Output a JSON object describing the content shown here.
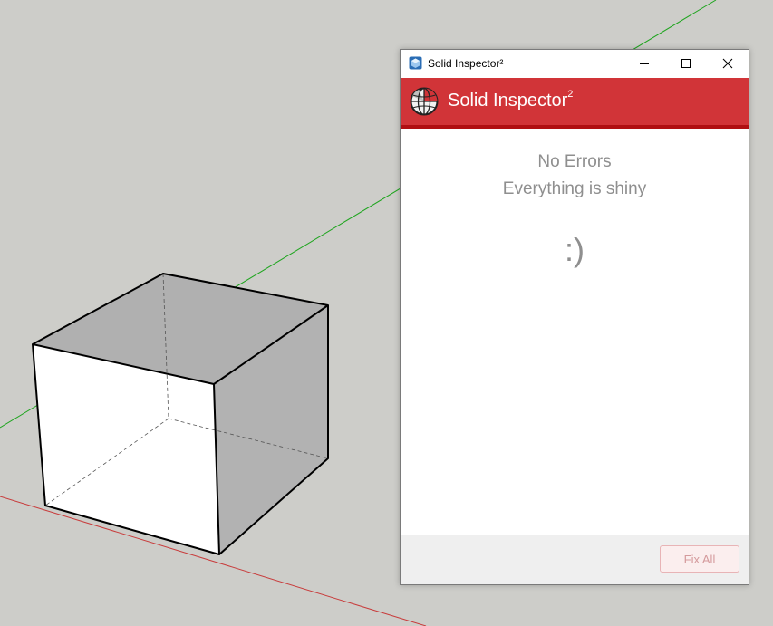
{
  "window": {
    "title": "Solid Inspector²",
    "controls": [
      "minimize-icon",
      "maximize-icon",
      "close-icon"
    ]
  },
  "header": {
    "title": "Solid Inspector",
    "superscript": "2",
    "logo_icon": "globe-icon"
  },
  "content": {
    "status_title": "No Errors",
    "status_subtitle": "Everything is shiny",
    "smiley": ":)"
  },
  "footer": {
    "fix_all_label": "Fix All",
    "fix_all_enabled": false
  },
  "colors": {
    "accent": "#d13438",
    "accent_dark": "#b00f12",
    "viewport_bg": "#cdcdc9",
    "green_axis": "#1fa51f",
    "red_axis": "#c83c3c"
  }
}
